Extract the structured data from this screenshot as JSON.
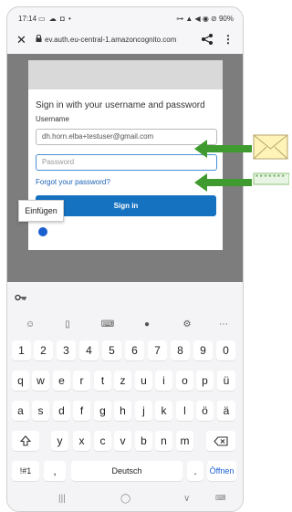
{
  "status": {
    "time": "17:14",
    "left_icons": "▭ ☁ ◘ •",
    "right_icons": "⊶ ▲ ◀ ◉ ⊘",
    "battery": "90%"
  },
  "browser": {
    "url": "ev.auth.eu-central-1.amazoncognito.com",
    "close_icon": "close-icon",
    "share_icon": "share-icon",
    "menu_icon": "more-vert-icon"
  },
  "form": {
    "heading": "Sign in with your username and password",
    "username_label": "Username",
    "username_value": "dh.horn.elba+testuser@gmail.com",
    "password_placeholder": "Password",
    "forgot_link": "Forgot your password?",
    "signin_button": "Sign in"
  },
  "context_menu": {
    "paste": "Einfügen"
  },
  "keyboard": {
    "row_numbers": [
      "1",
      "2",
      "3",
      "4",
      "5",
      "6",
      "7",
      "8",
      "9",
      "0"
    ],
    "row_q": [
      "q",
      "w",
      "e",
      "r",
      "t",
      "z",
      "u",
      "i",
      "o",
      "p",
      "ü"
    ],
    "row_a": [
      "a",
      "s",
      "d",
      "f",
      "g",
      "h",
      "j",
      "k",
      "l",
      "ö",
      "ä"
    ],
    "row_y": [
      "y",
      "x",
      "c",
      "v",
      "b",
      "n",
      "m"
    ],
    "symbols": "!#1",
    "comma": ",",
    "space": "Deutsch",
    "period": ".",
    "enter": "Öffnen",
    "key_icon": "key-icon",
    "toolbar_icons": [
      "emoji-icon",
      "clipboard-icon",
      "keyboard-icon",
      "mic-icon",
      "settings-icon",
      "more-icon"
    ]
  },
  "annotations": {
    "password_mask": "*******",
    "envelope_icon": "envelope-icon",
    "arrow_color": "#3f9a2f"
  }
}
